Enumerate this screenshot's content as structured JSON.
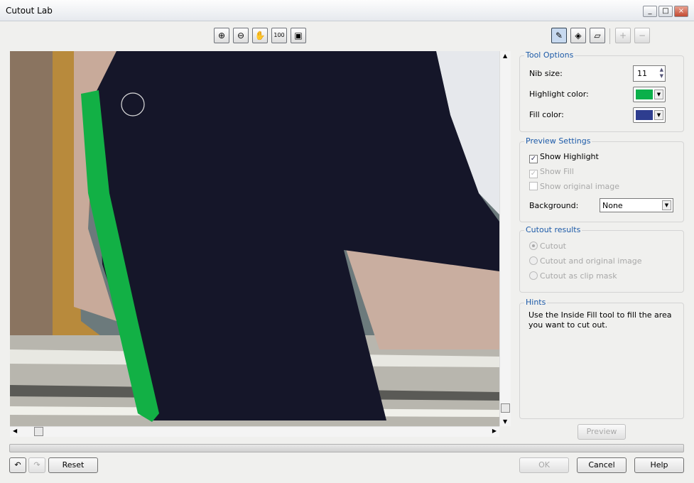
{
  "window": {
    "title": "Cutout Lab"
  },
  "toolbar": {
    "view_tools": [
      "zoom-in",
      "zoom-out",
      "pan",
      "actual-size",
      "fit-to-window"
    ],
    "edit_tools": [
      "highlighter",
      "inside-fill",
      "eraser",
      "add-detail",
      "remove-detail"
    ]
  },
  "tool_options": {
    "title": "Tool Options",
    "nib_label": "Nib size:",
    "nib_value": "11",
    "highlight_label": "Highlight color:",
    "highlight_color": "#0bb04a",
    "fill_label": "Fill color:",
    "fill_color": "#2e3d8f"
  },
  "preview_settings": {
    "title": "Preview Settings",
    "show_highlight": "Show Highlight",
    "show_fill": "Show Fill",
    "show_original": "Show original image",
    "background_label": "Background:",
    "background_value": "None"
  },
  "cutout_results": {
    "title": "Cutout results",
    "options": [
      "Cutout",
      "Cutout and original image",
      "Cutout as clip mask"
    ]
  },
  "hints": {
    "title": "Hints",
    "text": "Use the Inside Fill tool to fill the area you want to cut out."
  },
  "buttons": {
    "preview": "Preview",
    "reset": "Reset",
    "ok": "OK",
    "cancel": "Cancel",
    "help": "Help"
  }
}
